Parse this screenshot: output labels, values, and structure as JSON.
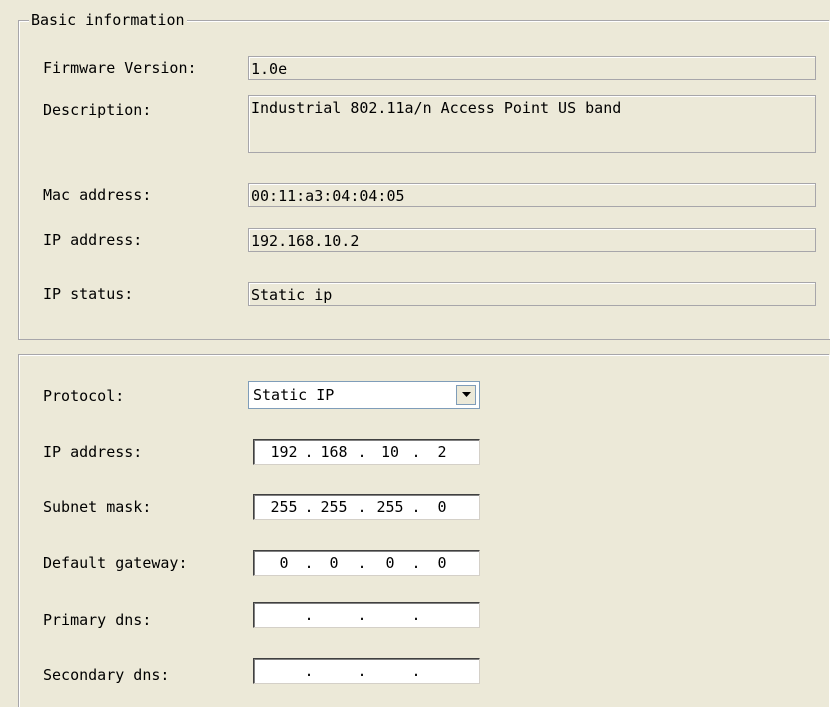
{
  "basic": {
    "legend": "Basic information",
    "firmware_label": "Firmware Version:",
    "firmware_value": "1.0e",
    "description_label": "Description:",
    "description_value": "Industrial 802.11a/n Access Point US band",
    "mac_label": "Mac address:",
    "mac_value": "00:11:a3:04:04:05",
    "ip_label": "IP address:",
    "ip_value": "192.168.10.2",
    "status_label": "IP status:",
    "status_value": "Static ip"
  },
  "network": {
    "protocol_label": "Protocol:",
    "protocol_value": "Static IP",
    "ip_label": "IP address:",
    "ip_octets": [
      "192",
      "168",
      "10",
      "2"
    ],
    "mask_label": "Subnet mask:",
    "mask_octets": [
      "255",
      "255",
      "255",
      "0"
    ],
    "gateway_label": "Default gateway:",
    "gateway_octets": [
      "0",
      "0",
      "0",
      "0"
    ],
    "primary_dns_label": "Primary dns:",
    "primary_dns_octets": [
      "",
      "",
      "",
      ""
    ],
    "secondary_dns_label": "Secondary dns:",
    "secondary_dns_octets": [
      "",
      "",
      "",
      ""
    ]
  }
}
